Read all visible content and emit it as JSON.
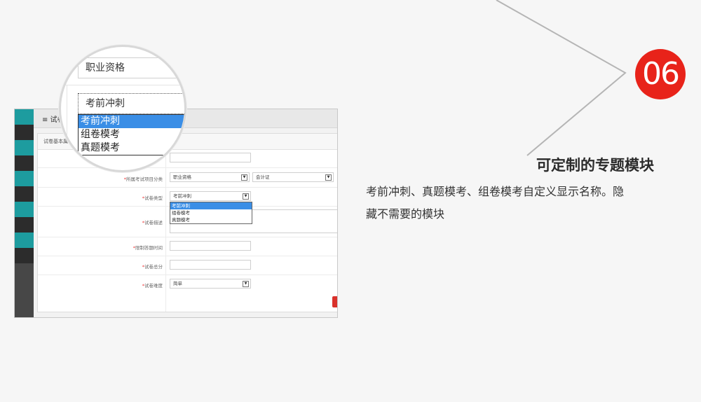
{
  "badge": {
    "number": "06"
  },
  "feature": {
    "title": "可定制的专题模块",
    "desc_line1": "考前冲刺、真题模考、组卷模考自定义显示名称。隐",
    "desc_line2": "藏不需要的模块"
  },
  "colors": {
    "badge": "#e8231a",
    "teal": "#1d9c9f",
    "highlight": "#3a8ee6"
  },
  "screenshot": {
    "topbar_title": "≡ 试卷",
    "panel_title": "试卷基本属",
    "fields": {
      "category_label": "所属考试项目分类",
      "category_value": "职业资格",
      "category_sub_value": "会计证",
      "type_label": "试卷类型",
      "type_value": "考前冲刺",
      "type_options": [
        "考前冲刺",
        "组卷模考",
        "真题模考"
      ],
      "desc_label": "试卷描述",
      "time_label": "限制答题时间",
      "score_label": "试卷总分",
      "difficulty_label": "试卷难度",
      "difficulty_value": "简单"
    }
  },
  "magnifier": {
    "category_value": "职业资格",
    "type_value": "考前冲刺",
    "options": [
      "考前冲刺",
      "组卷模考",
      "真题模考"
    ]
  }
}
